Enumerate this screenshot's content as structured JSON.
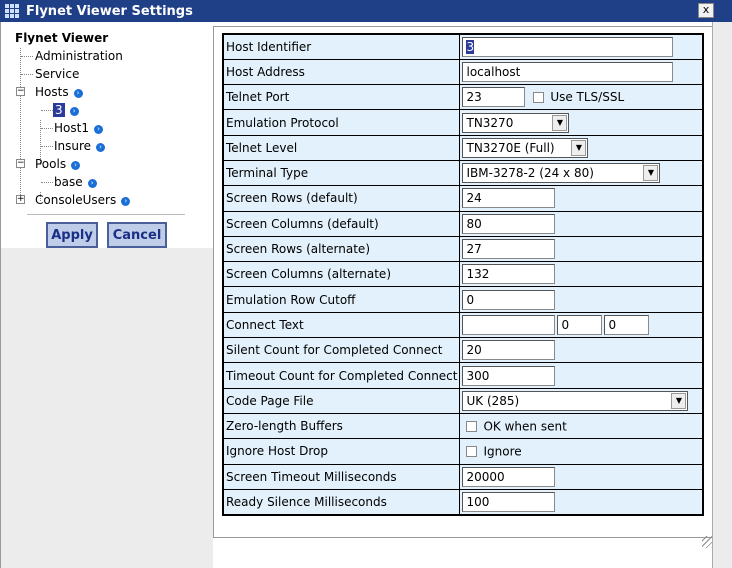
{
  "window": {
    "title": "Flynet Viewer Settings",
    "close_label": "x"
  },
  "tree": {
    "root": "Flynet Viewer",
    "items": {
      "administration": "Administration",
      "service": "Service",
      "hosts": "Hosts",
      "host_3": "3",
      "host1": "Host1",
      "insure": "Insure",
      "pools": "Pools",
      "base": "base",
      "consoleusers": "ConsoleUsers"
    }
  },
  "buttons": {
    "apply": "Apply",
    "cancel": "Cancel"
  },
  "settings": {
    "host_identifier": {
      "label": "Host Identifier",
      "value": "3"
    },
    "host_address": {
      "label": "Host Address",
      "value": "localhost"
    },
    "telnet_port": {
      "label": "Telnet Port",
      "value": "23",
      "tls_label": "Use TLS/SSL"
    },
    "emulation_protocol": {
      "label": "Emulation Protocol",
      "value": "TN3270"
    },
    "telnet_level": {
      "label": "Telnet Level",
      "value": "TN3270E (Full)"
    },
    "terminal_type": {
      "label": "Terminal Type",
      "value": "IBM-3278-2 (24 x 80)"
    },
    "screen_rows_default": {
      "label": "Screen Rows (default)",
      "value": "24"
    },
    "screen_cols_default": {
      "label": "Screen Columns (default)",
      "value": "80"
    },
    "screen_rows_alt": {
      "label": "Screen Rows (alternate)",
      "value": "27"
    },
    "screen_cols_alt": {
      "label": "Screen Columns (alternate)",
      "value": "132"
    },
    "emulation_row_cutoff": {
      "label": "Emulation Row Cutoff",
      "value": "0"
    },
    "connect_text": {
      "label": "Connect Text",
      "value1": "",
      "value2": "0",
      "value3": "0"
    },
    "silent_count": {
      "label": "Silent Count for Completed Connect",
      "value": "20"
    },
    "timeout_count": {
      "label": "Timeout Count for Completed Connect",
      "value": "300"
    },
    "code_page_file": {
      "label": "Code Page File",
      "value": "UK (285)"
    },
    "zero_length_buffers": {
      "label": "Zero-length Buffers",
      "check_label": "OK when sent"
    },
    "ignore_host_drop": {
      "label": "Ignore Host Drop",
      "check_label": "Ignore"
    },
    "screen_timeout_ms": {
      "label": "Screen Timeout Milliseconds",
      "value": "20000"
    },
    "ready_silence_ms": {
      "label": "Ready Silence Milliseconds",
      "value": "100"
    }
  }
}
